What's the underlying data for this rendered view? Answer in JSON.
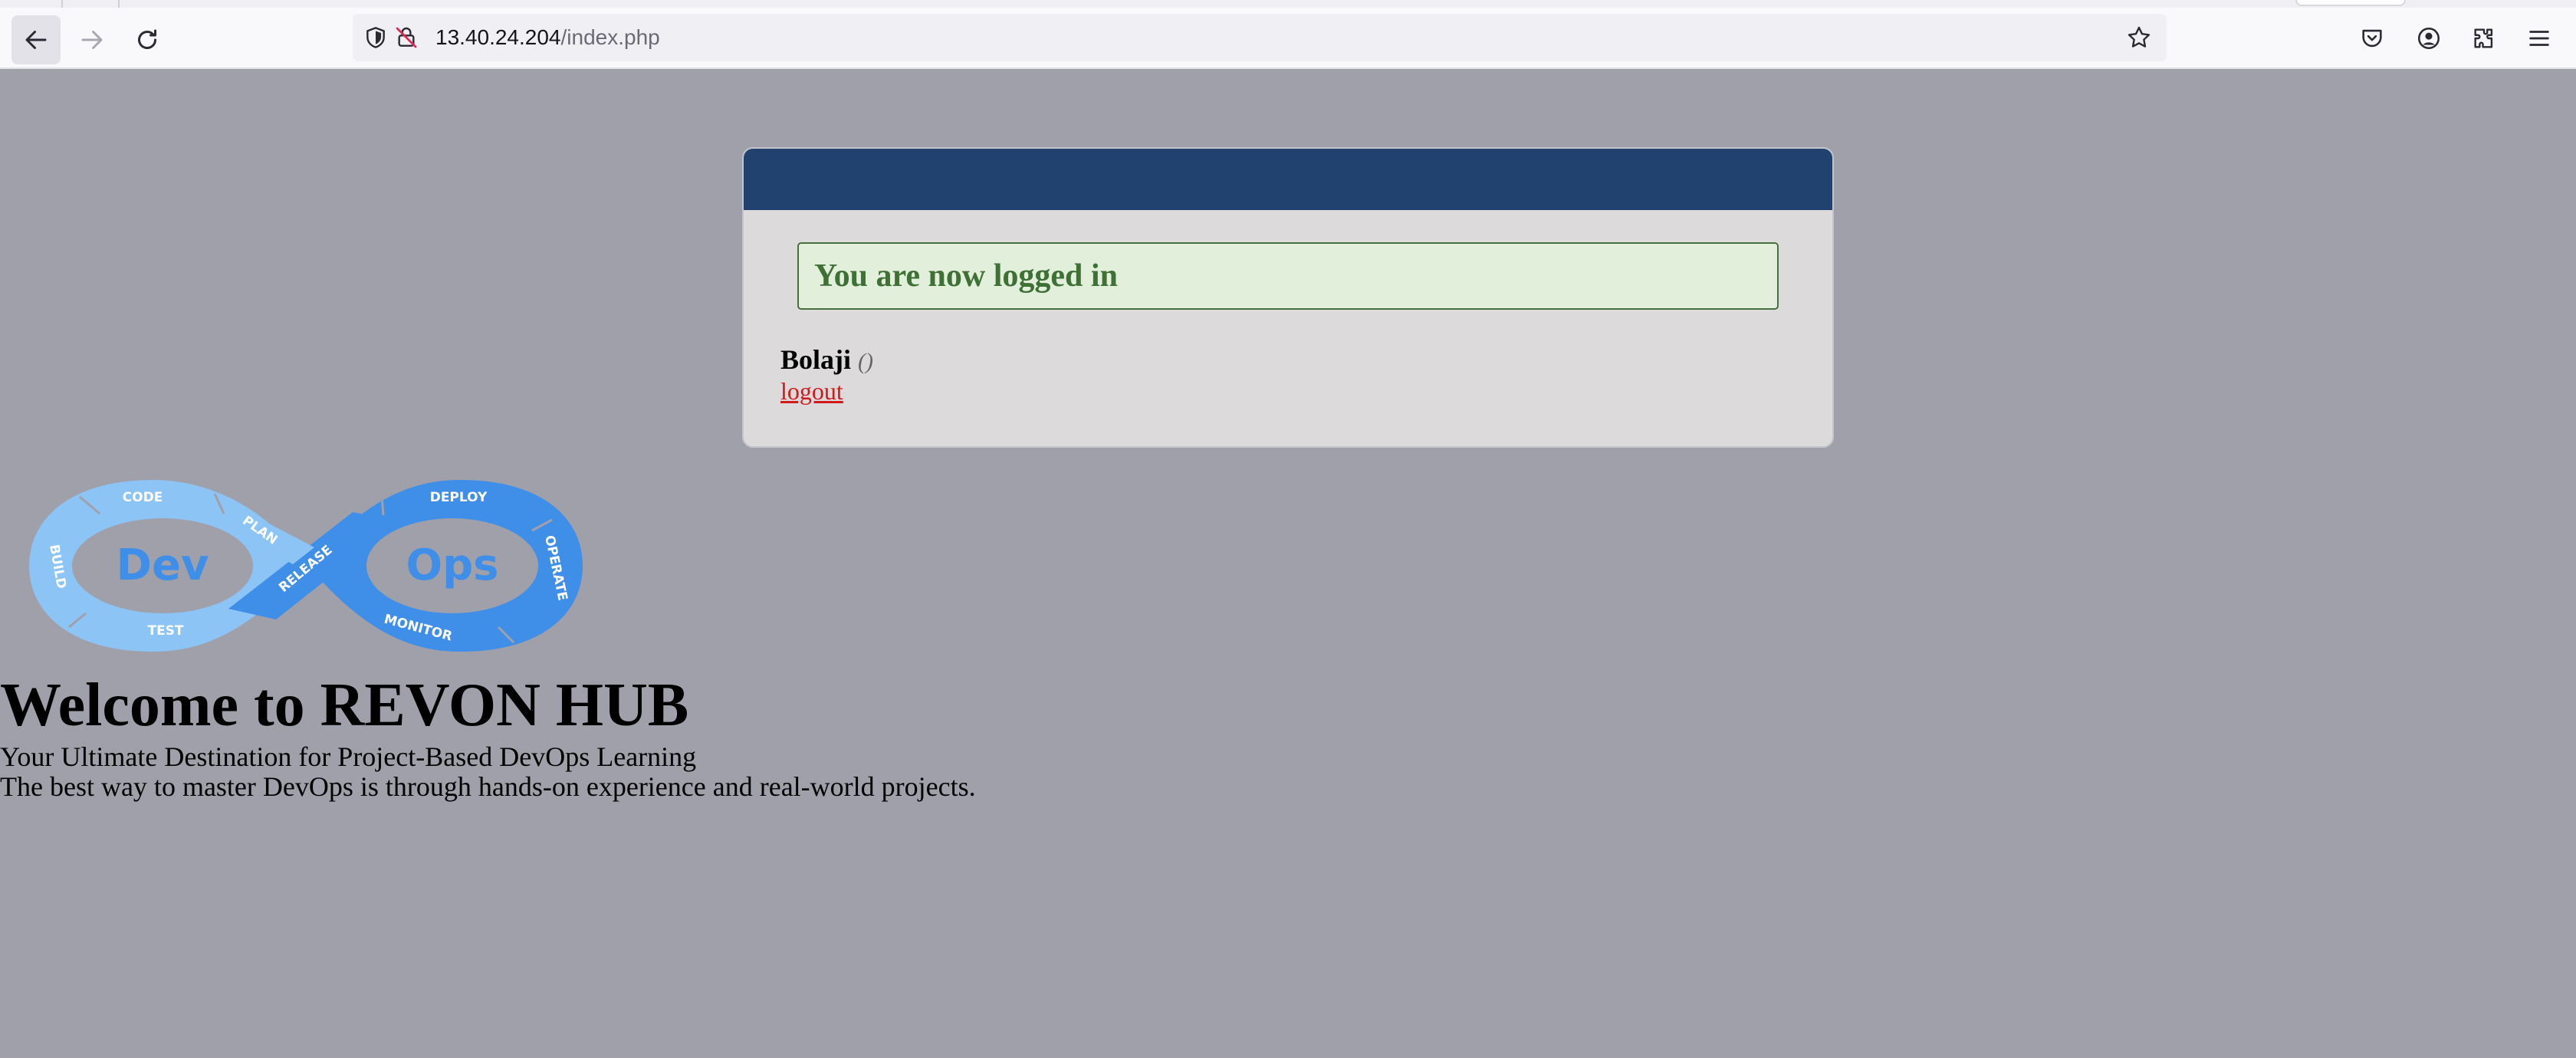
{
  "browser": {
    "url_host": "13.40.24.204",
    "url_path": "/index.php",
    "icons": {
      "back": "back-arrow-icon",
      "forward": "forward-arrow-icon",
      "reload": "reload-icon",
      "tracking": "shield-icon",
      "insecure": "insecure-lock-icon",
      "bookmark": "star-icon",
      "pocket": "pocket-icon",
      "account": "account-icon",
      "extensions": "extensions-icon",
      "menu": "hamburger-menu-icon"
    }
  },
  "card": {
    "header_color": "#21426f",
    "success_message": "You are now logged in",
    "username": "Bolaji",
    "role": "()",
    "logout_label": "logout"
  },
  "logo": {
    "left_word": "Dev",
    "right_word": "Ops",
    "stages": {
      "code": "CODE",
      "plan": "PLAN",
      "build": "BUILD",
      "test": "TEST",
      "release": "RELEASE",
      "deploy": "DEPLOY",
      "operate": "OPERATE",
      "monitor": "MONITOR"
    }
  },
  "main": {
    "title": "Welcome to REVON HUB",
    "tagline": "Your Ultimate Destination for Project-Based DevOps Learning",
    "description": "The best way to master DevOps is through hands-on experience and real-world projects."
  },
  "colors": {
    "page_background": "#a0a0ab",
    "card_background": "#dcdadb",
    "success_background": "#e1efdb",
    "success_text": "#3f7036",
    "logout_link": "#d11a1a",
    "logo_light_blue": "#8cc4f5",
    "logo_dark_blue": "#3f8ee8"
  }
}
